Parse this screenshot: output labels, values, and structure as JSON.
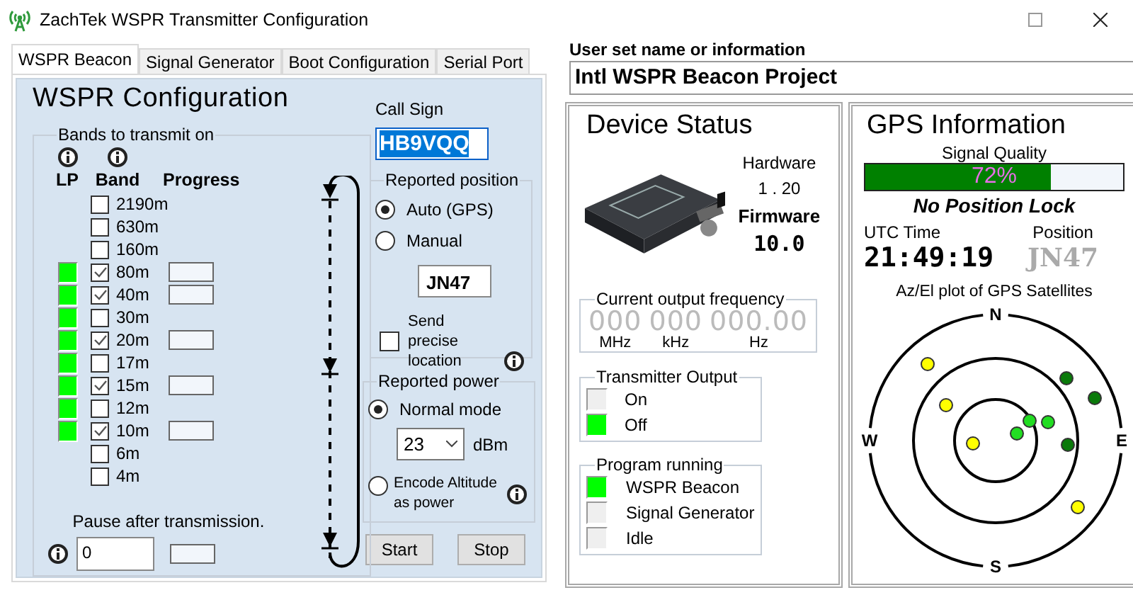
{
  "window": {
    "title": "ZachTek WSPR Transmitter Configuration"
  },
  "tabs": [
    {
      "label": "WSPR Beacon",
      "selected": true
    },
    {
      "label": "Signal Generator",
      "selected": false
    },
    {
      "label": "Boot Configuration",
      "selected": false
    },
    {
      "label": "Serial Port",
      "selected": false
    }
  ],
  "wspr_config": {
    "title": "WSPR Configuration",
    "bands_group": "Bands to transmit on",
    "columns": [
      "LP",
      "Band",
      "Progress"
    ],
    "bands": [
      {
        "name": "2190m",
        "checked": false,
        "lp": false
      },
      {
        "name": "630m",
        "checked": false,
        "lp": false
      },
      {
        "name": "160m",
        "checked": false,
        "lp": false
      },
      {
        "name": "80m",
        "checked": true,
        "lp": true
      },
      {
        "name": "40m",
        "checked": true,
        "lp": true
      },
      {
        "name": "30m",
        "checked": false,
        "lp": true
      },
      {
        "name": "20m",
        "checked": true,
        "lp": true
      },
      {
        "name": "17m",
        "checked": false,
        "lp": true
      },
      {
        "name": "15m",
        "checked": true,
        "lp": true
      },
      {
        "name": "12m",
        "checked": false,
        "lp": true
      },
      {
        "name": "10m",
        "checked": true,
        "lp": true
      },
      {
        "name": "6m",
        "checked": false,
        "lp": false
      },
      {
        "name": "4m",
        "checked": false,
        "lp": false
      }
    ],
    "pause_label": "Pause after transmission.",
    "pause_value": "0"
  },
  "call_sign": {
    "label": "Call Sign",
    "value": "HB9VQQ"
  },
  "reported_position": {
    "title": "Reported position",
    "options": [
      {
        "label": "Auto (GPS)",
        "selected": true
      },
      {
        "label": "Manual",
        "selected": false
      }
    ],
    "locator": "JN47",
    "precise": {
      "label": "Send precise location",
      "checked": false
    }
  },
  "reported_power": {
    "title": "Reported power",
    "options": [
      {
        "label": "Normal mode",
        "selected": true
      },
      {
        "label": "Encode Altitude as power",
        "selected": false
      }
    ],
    "dbm_value": "23",
    "unit": "dBm"
  },
  "buttons": [
    "Start",
    "Stop"
  ],
  "user_info": {
    "label": "User set name or information",
    "value": "Intl WSPR Beacon Project"
  },
  "device_status": {
    "title": "Device Status",
    "hardware_label": "Hardware",
    "hardware": "1 . 20",
    "firmware_label": "Firmware",
    "firmware": "10.0",
    "frequency": {
      "title": "Current output frequency",
      "digits": [
        "000",
        "000",
        "000.00"
      ],
      "units": [
        "MHz",
        "kHz",
        "Hz"
      ]
    },
    "transmitter_output": {
      "title": "Transmitter Output",
      "items": [
        {
          "label": "On",
          "on": false
        },
        {
          "label": "Off",
          "on": true
        }
      ]
    },
    "program_running": {
      "title": "Program running",
      "items": [
        {
          "label": "WSPR Beacon",
          "on": true
        },
        {
          "label": "Signal Generator",
          "on": false
        },
        {
          "label": "Idle",
          "on": false
        }
      ]
    }
  },
  "gps": {
    "title": "GPS Information",
    "signal_label": "Signal Quality",
    "level": 0.72,
    "signal_reading": "72%",
    "lock_status": "No Position Lock",
    "utc_label": "UTC Time",
    "utc": "21:49:19",
    "position_label": "Position",
    "position": "JN47",
    "plot_title": "Az/El plot of GPS Satellites",
    "compass": [
      "N",
      "E",
      "S",
      "W"
    ]
  }
}
